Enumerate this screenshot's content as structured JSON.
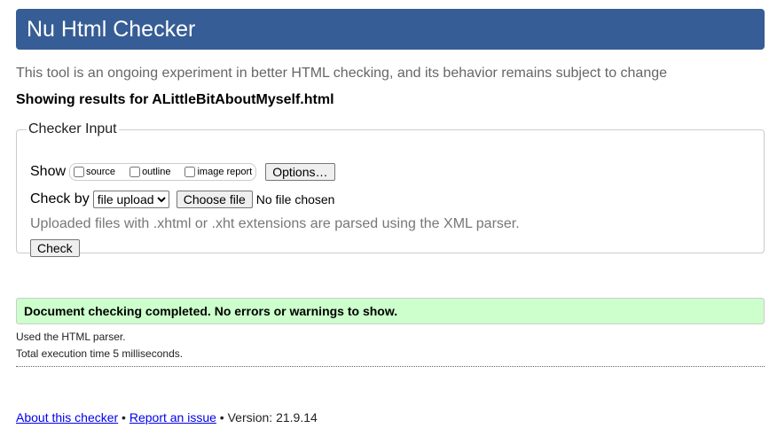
{
  "header": {
    "title": "Nu Html Checker"
  },
  "intro": "This tool is an ongoing experiment in better HTML checking, and its behavior remains subject to change",
  "showing": "Showing results for ALittleBitAboutMyself.html",
  "form": {
    "legend": "Checker Input",
    "show_label": "Show",
    "options": [
      {
        "label": "source",
        "checked": false
      },
      {
        "label": "outline",
        "checked": false
      },
      {
        "label": "image report",
        "checked": false
      }
    ],
    "options_button": "Options…",
    "checkby_label": "Check by",
    "checkby_value": "file upload",
    "choose_file": "Choose file",
    "no_file": "No file chosen",
    "note": "Uploaded files with .xhtml or .xht extensions are parsed using the XML parser.",
    "check_button": "Check"
  },
  "result": {
    "message": "Document checking completed. No errors or warnings to show.",
    "parser": "Used the HTML parser.",
    "time": "Total execution time 5 milliseconds.",
    "color": "#ccffcc"
  },
  "footer": {
    "about": "About this checker",
    "sep": " • ",
    "report": "Report an issue",
    "version": "Version: 21.9.14"
  }
}
